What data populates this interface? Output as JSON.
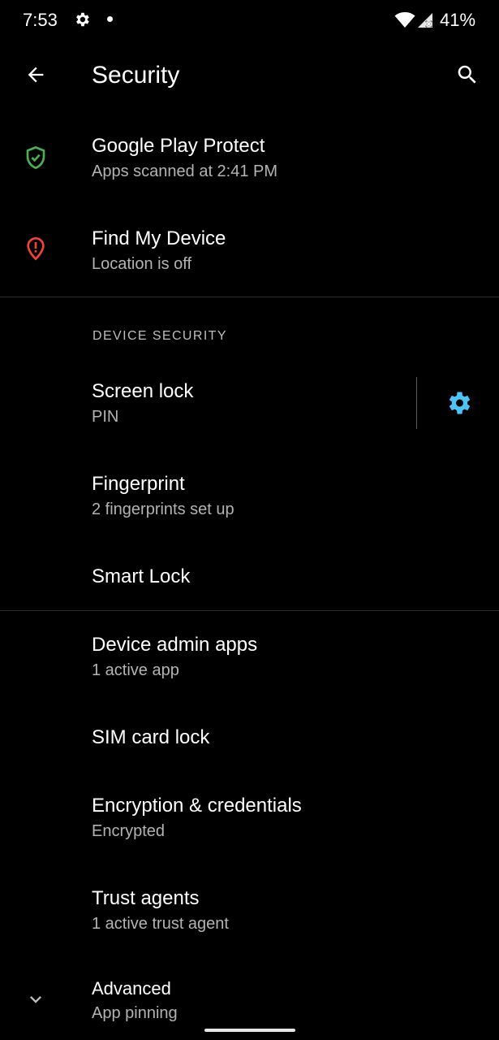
{
  "status_bar": {
    "time": "7:53",
    "battery": "41%"
  },
  "app_bar": {
    "title": "Security"
  },
  "items": {
    "play_protect": {
      "title": "Google Play Protect",
      "summary": "Apps scanned at 2:41 PM",
      "icon_color": "#4caf50"
    },
    "find_device": {
      "title": "Find My Device",
      "summary": "Location is off",
      "icon_color": "#f44336"
    },
    "screen_lock": {
      "title": "Screen lock",
      "summary": "PIN",
      "gear_color": "#4fc3f7"
    },
    "fingerprint": {
      "title": "Fingerprint",
      "summary": "2 fingerprints set up"
    },
    "smart_lock": {
      "title": "Smart Lock"
    },
    "device_admin": {
      "title": "Device admin apps",
      "summary": "1 active app"
    },
    "sim_lock": {
      "title": "SIM card lock"
    },
    "encryption": {
      "title": "Encryption & credentials",
      "summary": "Encrypted"
    },
    "trust_agents": {
      "title": "Trust agents",
      "summary": "1 active trust agent"
    },
    "advanced": {
      "title": "Advanced",
      "summary": "App pinning"
    }
  },
  "sections": {
    "device_security": "DEVICE SECURITY"
  }
}
